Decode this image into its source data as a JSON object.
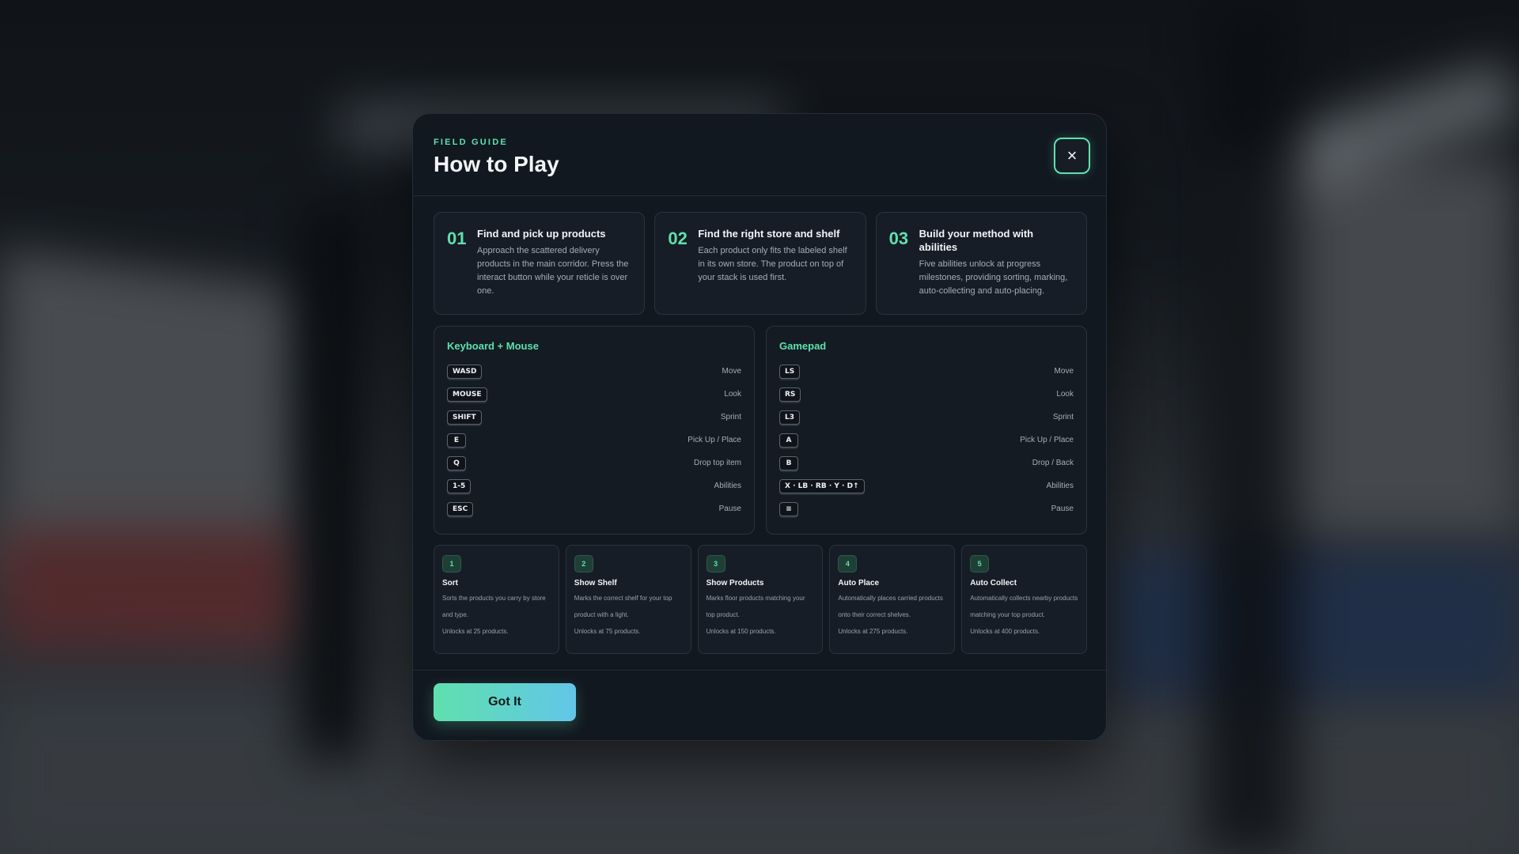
{
  "modal": {
    "eyebrow": "FIELD GUIDE",
    "title": "How to Play",
    "close_icon": "×"
  },
  "steps": [
    {
      "num": "01",
      "title": "Find and pick up products",
      "desc": "Approach the scattered delivery products in the main corridor. Press the interact button while your reticle is over one."
    },
    {
      "num": "02",
      "title": "Find the right store and shelf",
      "desc": "Each product only fits the labeled shelf in its own store. The product on top of your stack is used first."
    },
    {
      "num": "03",
      "title": "Build your method with abilities",
      "desc": "Five abilities unlock at progress milestones, providing sorting, marking, auto-collecting and auto-placing."
    }
  ],
  "keyboard": {
    "title": "Keyboard + Mouse",
    "rows": [
      {
        "key": "WASD",
        "action": "Move"
      },
      {
        "key": "MOUSE",
        "action": "Look"
      },
      {
        "key": "SHIFT",
        "action": "Sprint"
      },
      {
        "key": "E",
        "action": "Pick Up / Place"
      },
      {
        "key": "Q",
        "action": "Drop top item"
      },
      {
        "key": "1-5",
        "action": "Abilities"
      },
      {
        "key": "ESC",
        "action": "Pause"
      }
    ]
  },
  "gamepad": {
    "title": "Gamepad",
    "rows": [
      {
        "key": "LS",
        "action": "Move"
      },
      {
        "key": "RS",
        "action": "Look"
      },
      {
        "key": "L3",
        "action": "Sprint"
      },
      {
        "key": "A",
        "action": "Pick Up / Place"
      },
      {
        "key": "B",
        "action": "Drop / Back"
      },
      {
        "key": "X · LB · RB · Y · D↑",
        "action": "Abilities"
      },
      {
        "key": "≡",
        "action": "Pause"
      }
    ]
  },
  "abilities": [
    {
      "num": "1",
      "title": "Sort",
      "desc": "Sorts the products you carry by store and type.",
      "unlock": "Unlocks at 25 products."
    },
    {
      "num": "2",
      "title": "Show Shelf",
      "desc": "Marks the correct shelf for your top product with a light.",
      "unlock": "Unlocks at 75 products."
    },
    {
      "num": "3",
      "title": "Show Products",
      "desc": "Marks floor products matching your top product.",
      "unlock": "Unlocks at 150 products."
    },
    {
      "num": "4",
      "title": "Auto Place",
      "desc": "Automatically places carried products onto their correct shelves.",
      "unlock": "Unlocks at 275 products."
    },
    {
      "num": "5",
      "title": "Auto Collect",
      "desc": "Automatically collects nearby products matching your top product.",
      "unlock": "Unlocks at 400 products."
    }
  ],
  "footer": {
    "got_it_label": "Got It"
  },
  "colors": {
    "accent": "#5fe0ad",
    "accent2": "#62c6e8",
    "panel": "#121820"
  }
}
